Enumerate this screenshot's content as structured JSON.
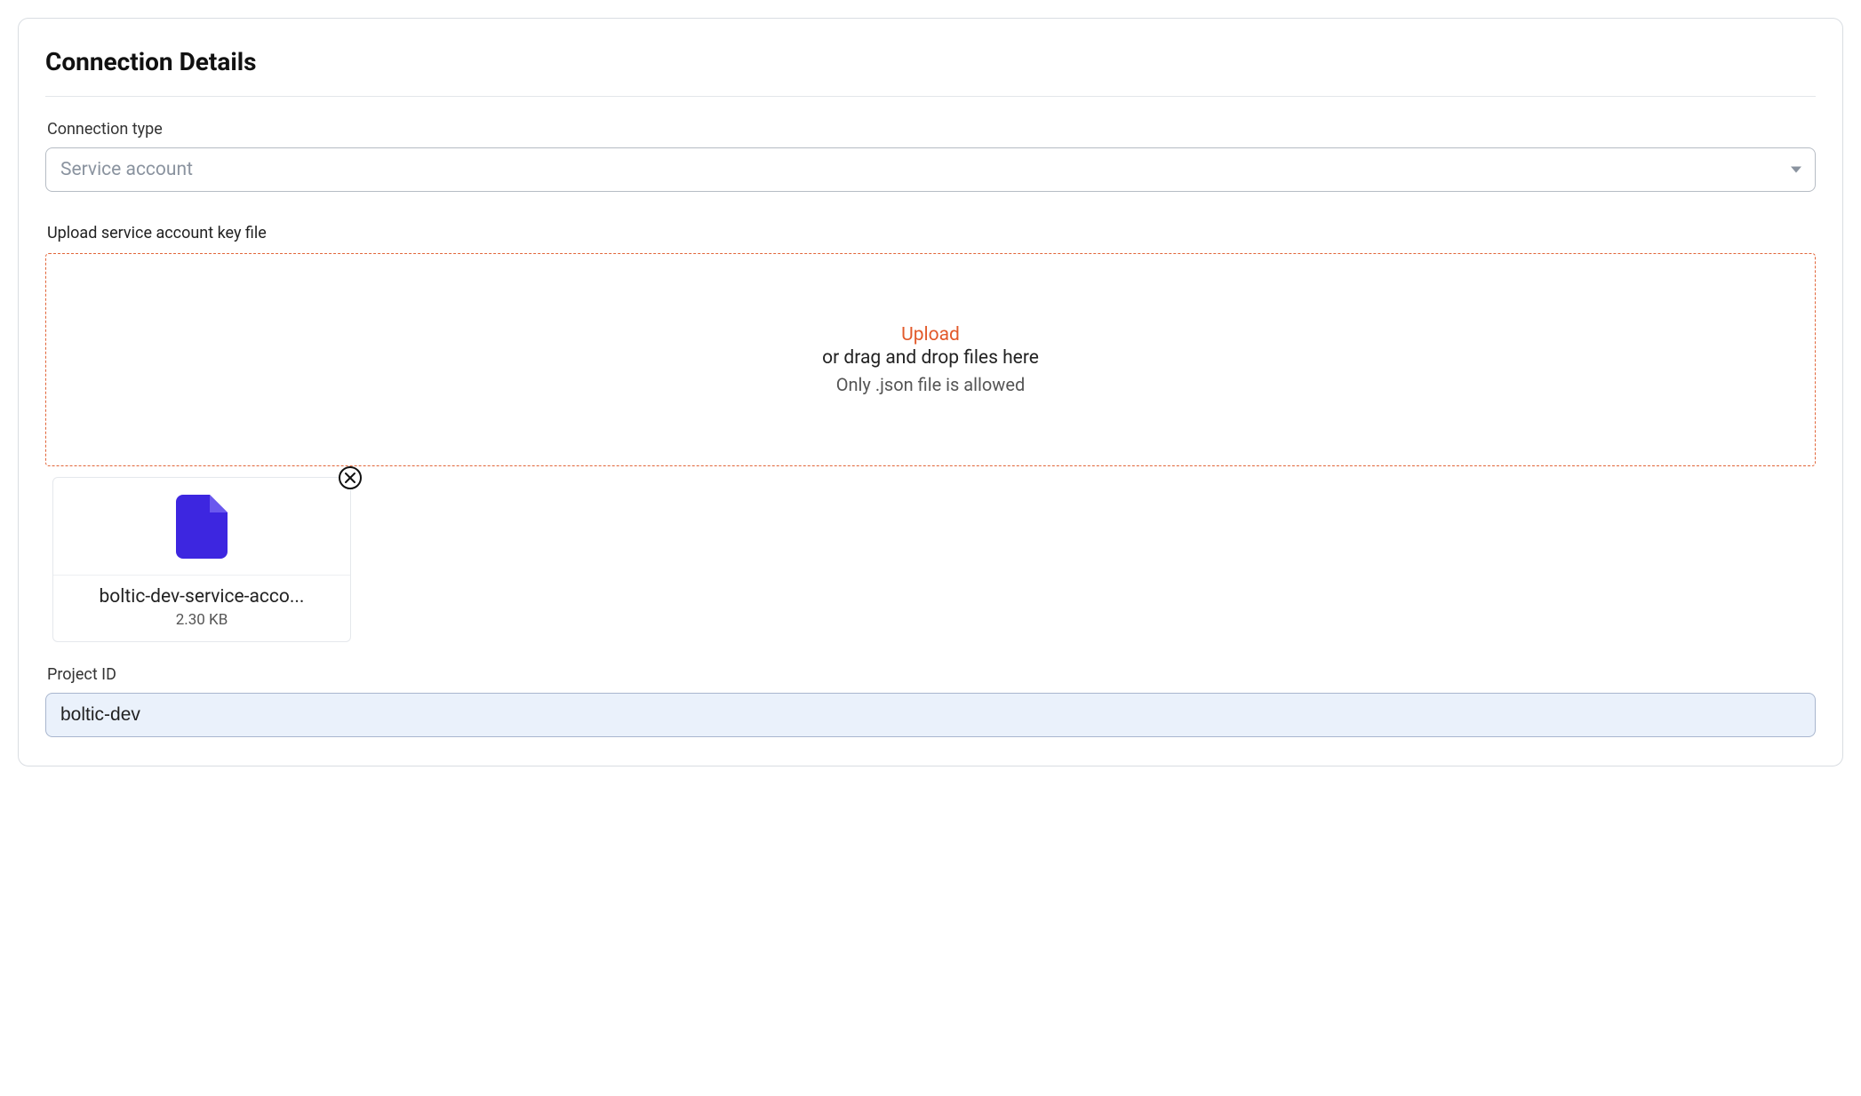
{
  "section": {
    "title": "Connection Details"
  },
  "connection_type": {
    "label": "Connection type",
    "value": "Service account"
  },
  "upload": {
    "label": "Upload service account key file",
    "link_text": "Upload",
    "subtext": "or drag and drop files here",
    "hint": "Only .json file is allowed"
  },
  "uploaded_file": {
    "name": "boltic-dev-service-acco...",
    "size": "2.30 KB"
  },
  "project_id": {
    "label": "Project ID",
    "value": "boltic-dev"
  }
}
